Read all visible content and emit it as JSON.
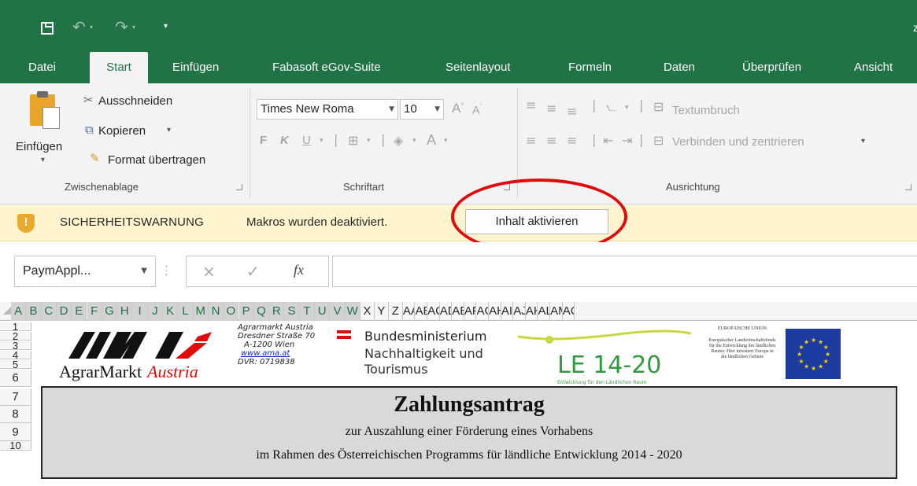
{
  "titlebar": {
    "save_icon": "save-icon",
    "undo_icon": "undo-icon",
    "redo_icon": "redo-icon",
    "customize_icon": "customize-qat-icon",
    "title_fragment": "z"
  },
  "tabs": [
    {
      "label": "Datei",
      "active": false
    },
    {
      "label": "Start",
      "active": true
    },
    {
      "label": "Einfügen",
      "active": false
    },
    {
      "label": "Fabasoft eGov-Suite",
      "active": false
    },
    {
      "label": "Seitenlayout",
      "active": false
    },
    {
      "label": "Formeln",
      "active": false
    },
    {
      "label": "Daten",
      "active": false
    },
    {
      "label": "Überprüfen",
      "active": false
    },
    {
      "label": "Ansicht",
      "active": false
    }
  ],
  "ribbon": {
    "clipboard": {
      "paste_label": "Einfügen",
      "cut_label": "Ausschneiden",
      "copy_label": "Kopieren",
      "format_painter_label": "Format übertragen",
      "group_label": "Zwischenablage"
    },
    "font": {
      "font_name": "Times New Roma",
      "font_size": "10",
      "bold": "F",
      "italic": "K",
      "underline": "U",
      "font_color_letter": "A",
      "grow_letter": "A",
      "shrink_letter": "A",
      "group_label": "Schriftart"
    },
    "alignment": {
      "wrap_label": "Textumbruch",
      "merge_label": "Verbinden und zentrieren",
      "group_label": "Ausrichtung"
    }
  },
  "security_bar": {
    "title": "SICHERHEITSWARNUNG",
    "message": "Makros wurden deaktiviert.",
    "button_label": "Inhalt aktivieren",
    "accent_color": "#e10a0a"
  },
  "formula_bar": {
    "name_box": "PaymAppl...",
    "cancel_icon": "×",
    "enter_icon": "✓",
    "fx_label": "fx",
    "value": ""
  },
  "sheet": {
    "columns": [
      "A",
      "B",
      "C",
      "D",
      "E",
      "F",
      "G",
      "H",
      "I",
      "J",
      "K",
      "L",
      "M",
      "N",
      "O",
      "P",
      "Q",
      "R",
      "S",
      "T",
      "U",
      "V",
      "W",
      "X",
      "Y",
      "Z",
      "AA",
      "AE",
      "AC",
      "AD",
      "AE",
      "AF",
      "AG",
      "AH",
      "AI",
      "AJ",
      "AK",
      "AL",
      "AM",
      "AC"
    ],
    "rows": [
      "1",
      "2",
      "3",
      "4",
      "5",
      "6",
      "7",
      "8",
      "9",
      "10"
    ],
    "logos": {
      "ama_wordmark": "AgrarMarkt",
      "ama_wordmark_accent": "Austria",
      "ama_address": [
        "Agrarmarkt Austria",
        "Dresdner Straße 70",
        "A-1200 Wien",
        "www.ama.at",
        "DVR: 0719838"
      ],
      "bm_title": "Bundesministerium",
      "bm_subtitle_1": "Nachhaltigkeit und",
      "bm_subtitle_2": "Tourismus",
      "le_text": "LE 14-20",
      "le_sub": "Entwicklung für den Ländlichen Raum",
      "eu_title": "EUROPÄISCHE UNION",
      "eu_text": "Europäischer Landwirtschaftsfonds für die Entwicklung des ländlichen Raums: Hier investiert Europa in die ländlichen Gebiete"
    },
    "title": "Zahlungsantrag",
    "subtitle_1": "zur Auszahlung einer Förderung eines Vorhabens",
    "subtitle_2": "im Rahmen des Österreichischen Programms für ländliche Entwicklung 2014 - 2020"
  }
}
